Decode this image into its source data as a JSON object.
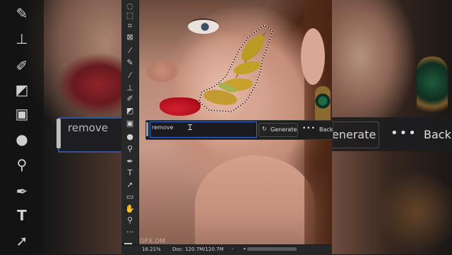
{
  "taskbar": {
    "prompt_value": "remove",
    "generate_label": "Generate",
    "more_label": "•••",
    "back_label": "Back"
  },
  "statusbar": {
    "zoom": "16.21%",
    "doc": "Doc: 120.7M/120.7M"
  },
  "watermark": "GFX.OM",
  "background_zoom": {
    "left_prompt": "remove",
    "right_generate": "enerate",
    "right_more": "•••",
    "right_back": "Back"
  },
  "tools": [
    {
      "icon": "lasso-icon",
      "glyph": "◌"
    },
    {
      "icon": "object-select-icon",
      "glyph": "⬚"
    },
    {
      "icon": "crop-icon",
      "glyph": "⌗"
    },
    {
      "icon": "frame-icon",
      "glyph": "⊠"
    },
    {
      "icon": "eyedropper-icon",
      "glyph": "⁄"
    },
    {
      "icon": "healing-brush-icon",
      "glyph": "✎"
    },
    {
      "icon": "brush-icon",
      "glyph": "⁄"
    },
    {
      "icon": "clone-stamp-icon",
      "glyph": "⊥"
    },
    {
      "icon": "history-brush-icon",
      "glyph": "✐"
    },
    {
      "icon": "eraser-icon",
      "glyph": "◩"
    },
    {
      "icon": "gradient-icon",
      "glyph": "▣"
    },
    {
      "icon": "blur-icon",
      "glyph": "●"
    },
    {
      "icon": "dodge-icon",
      "glyph": "⚲"
    },
    {
      "icon": "pen-icon",
      "glyph": "✒"
    },
    {
      "icon": "type-icon",
      "glyph": "T"
    },
    {
      "icon": "path-select-icon",
      "glyph": "➚"
    },
    {
      "icon": "rectangle-icon",
      "glyph": "▭"
    },
    {
      "icon": "hand-icon",
      "glyph": "✋"
    },
    {
      "icon": "zoom-icon",
      "glyph": "⚲"
    },
    {
      "icon": "more-tools-icon",
      "glyph": "···"
    }
  ],
  "colors": {
    "accent_blue": "#3a6ad4",
    "foreground_swatch": "#c9a592",
    "background_swatch": "#ffffff"
  }
}
